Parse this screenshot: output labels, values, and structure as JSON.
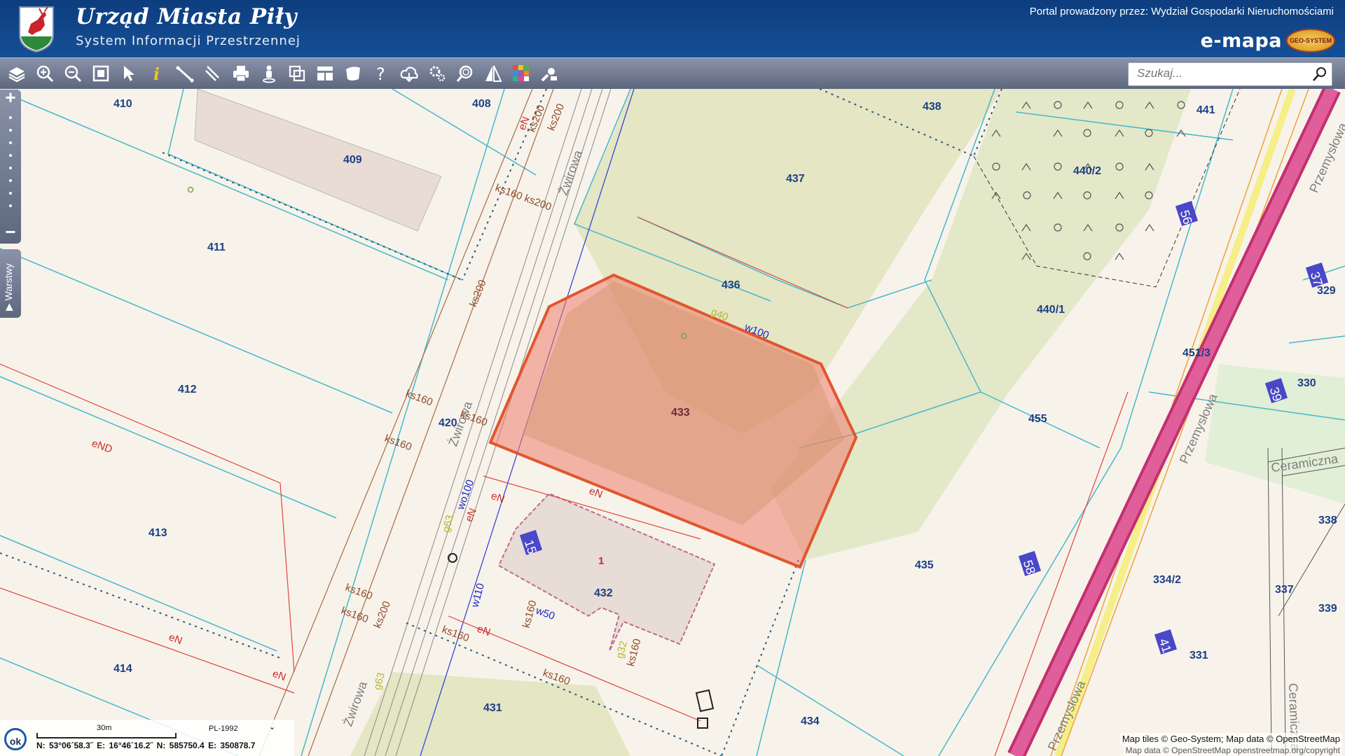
{
  "header": {
    "title": "Urząd Miasta Piły",
    "subtitle": "System Informacji Przestrzennej",
    "provider": "Portal prowadzony przez: Wydział Gospodarki Nieruchomościami",
    "brand": "e-mapa",
    "brand_badge": "GEO-SYSTEM"
  },
  "toolbar": {
    "tools": [
      "layers-icon",
      "zoom-in-icon",
      "zoom-out-icon",
      "zoom-extent-icon",
      "select-pointer-icon",
      "info-icon",
      "measure-distance-icon",
      "measure-area-icon",
      "print-icon",
      "street-view-icon",
      "copy-map-icon",
      "layout-icon",
      "map-shape-icon",
      "help-icon",
      "cloud-download-icon",
      "settings-icon",
      "search-zoom-icon",
      "compare-icon",
      "color-palette-icon",
      "tools-icon"
    ]
  },
  "search": {
    "placeholder": "Szukaj..."
  },
  "sidebar": {
    "zoom_in": "+",
    "zoom_out": "−",
    "layers_tab": "Warstwy"
  },
  "map": {
    "parcels": [
      "410",
      "408",
      "409",
      "411",
      "412",
      "413",
      "414",
      "420",
      "431",
      "432",
      "433",
      "434",
      "435",
      "436",
      "437",
      "438",
      "440/1",
      "440/2",
      "441",
      "451/3",
      "455",
      "329",
      "330",
      "331",
      "334/2",
      "337",
      "338",
      "339"
    ],
    "building_numbers": [
      "1"
    ],
    "address_badges": [
      "15",
      "56",
      "37",
      "39",
      "58",
      "41"
    ],
    "streets": [
      "Żwirowa",
      "Żwirowa",
      "Żwirowa",
      "Przemysłowa",
      "Przemysłowa",
      "Przemysłowa",
      "Ceramiczna",
      "Ceramiczna"
    ],
    "utility_labels": [
      "ks200",
      "ks200",
      "ks160 ks200",
      "ks200",
      "ks160",
      "ks160",
      "ks160",
      "ks160",
      "ks160",
      "ks160",
      "ks160",
      "ks160",
      "ks160",
      "ks200",
      "eN",
      "eN",
      "eN",
      "eN",
      "eN",
      "eN",
      "eND",
      "eN",
      "eN",
      "w100",
      "wo100",
      "w110",
      "w50",
      "g40",
      "g63",
      "g63",
      "g32"
    ]
  },
  "attribution": {
    "line1": "Map tiles © Geo-System; Map data © OpenStreetMap",
    "line2": "Map data © OpenStreetMap  openstreetmap.org/copyright"
  },
  "coordbar": {
    "ok": "ok",
    "scale": "30m",
    "crs": "PL-1992",
    "coords": "N: 53°06´58.3˝  E: 16°46´16.2˝   N: 585750.4   E: 350878.7"
  }
}
